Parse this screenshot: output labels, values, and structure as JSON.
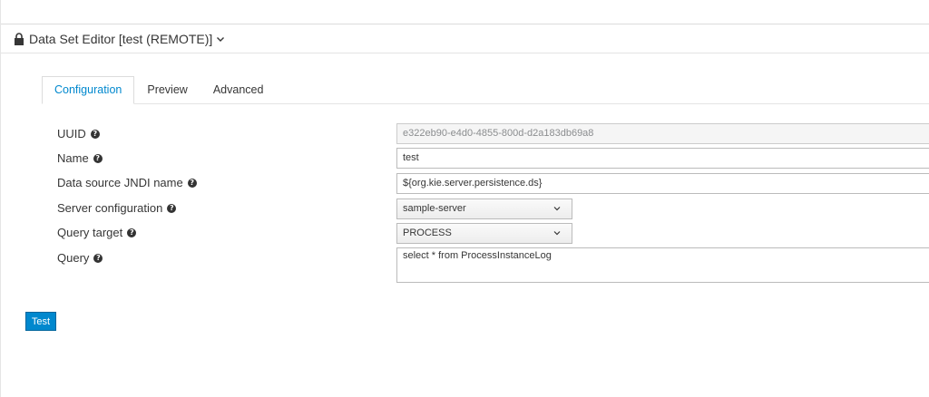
{
  "header": {
    "title": "Data Set Editor [test (REMOTE)]"
  },
  "tabs": [
    {
      "label": "Configuration",
      "active": true
    },
    {
      "label": "Preview",
      "active": false
    },
    {
      "label": "Advanced",
      "active": false
    }
  ],
  "form": {
    "uuid": {
      "label": "UUID",
      "value": "e322eb90-e4d0-4855-800d-d2a183db69a8"
    },
    "name": {
      "label": "Name",
      "value": "test"
    },
    "jndi": {
      "label": "Data source JNDI name",
      "value": "${org.kie.server.persistence.ds}"
    },
    "server_config": {
      "label": "Server configuration",
      "value": "sample-server"
    },
    "query_target": {
      "label": "Query target",
      "value": "PROCESS"
    },
    "query": {
      "label": "Query",
      "value": "select * from ProcessInstanceLog"
    }
  },
  "actions": {
    "test_label": "Test"
  },
  "colors": {
    "accent": "#0088ce",
    "text": "#363636"
  },
  "icons": {
    "lock": "lock-icon",
    "chevron": "chevron-down-icon",
    "help": "question-circle-icon",
    "caret": "caret-down-icon"
  }
}
